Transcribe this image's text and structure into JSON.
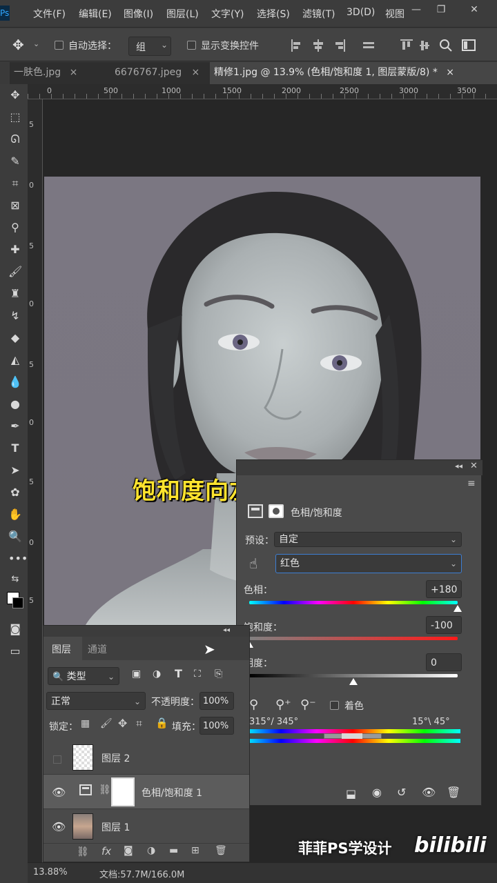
{
  "menu": [
    "文件(F)",
    "编辑(E)",
    "图像(I)",
    "图层(L)",
    "文字(Y)",
    "选择(S)",
    "滤镜(T)",
    "3D(D)",
    "视图"
  ],
  "window_controls": {
    "minimize": "—",
    "restore": "❐",
    "close": "✕"
  },
  "options": {
    "auto_select_label": "自动选择：",
    "auto_select_value": "组",
    "show_transform_label": "显示变换控件"
  },
  "tabs": [
    {
      "label": "一肤色.jpg",
      "close": "×"
    },
    {
      "label": "6676767.jpeg",
      "close": "×"
    },
    {
      "label": "精修1.jpg @ 13.9% (色相/饱和度 1, 图层蒙版/8) *",
      "close": "×"
    }
  ],
  "ruler_top_labels": [
    "0",
    "500",
    "1000",
    "1500",
    "2000",
    "2500",
    "3000",
    "3500"
  ],
  "ruler_left_labels": [
    "5",
    "0",
    "5",
    "0",
    "5",
    "0",
    "5",
    "0",
    "5"
  ],
  "subtitle": "饱和度向左拉到最低",
  "properties": {
    "collapse": "◂◂",
    "close": "✕",
    "menu": "≡",
    "title": "色相/饱和度",
    "preset_label": "预设：",
    "preset_value": "自定",
    "channel_value": "红色",
    "hue_label": "色相：",
    "hue_value": "+180",
    "saturation_label": "饱和度：",
    "saturation_value": "-100",
    "lightness_label": "明度：",
    "lightness_value": "0",
    "colorize_label": "着色",
    "range_left": "315°/ 345°",
    "range_right": "15°\\ 45°"
  },
  "slider_levels": {
    "hue": 1.0,
    "saturation": 0.0,
    "lightness": 0.5
  },
  "layers_panel": {
    "tab_layers": "图层",
    "tab_channels": "通道",
    "filter_label": "类型",
    "blend_mode": "正常",
    "opacity_label": "不透明度：",
    "opacity_value": "100%",
    "lock_label": "锁定：",
    "fill_label": "填充：",
    "fill_value": "100%",
    "layers": [
      {
        "name": "图层 2",
        "visible": false
      },
      {
        "name": "色相/饱和度 1",
        "visible": true
      },
      {
        "name": "图层 1",
        "visible": true
      }
    ]
  },
  "status": {
    "zoom": "13.88%",
    "doc": "文档:57.7M/166.0M"
  },
  "watermark": "菲菲PS学设计",
  "bili_logo": "bilibili"
}
